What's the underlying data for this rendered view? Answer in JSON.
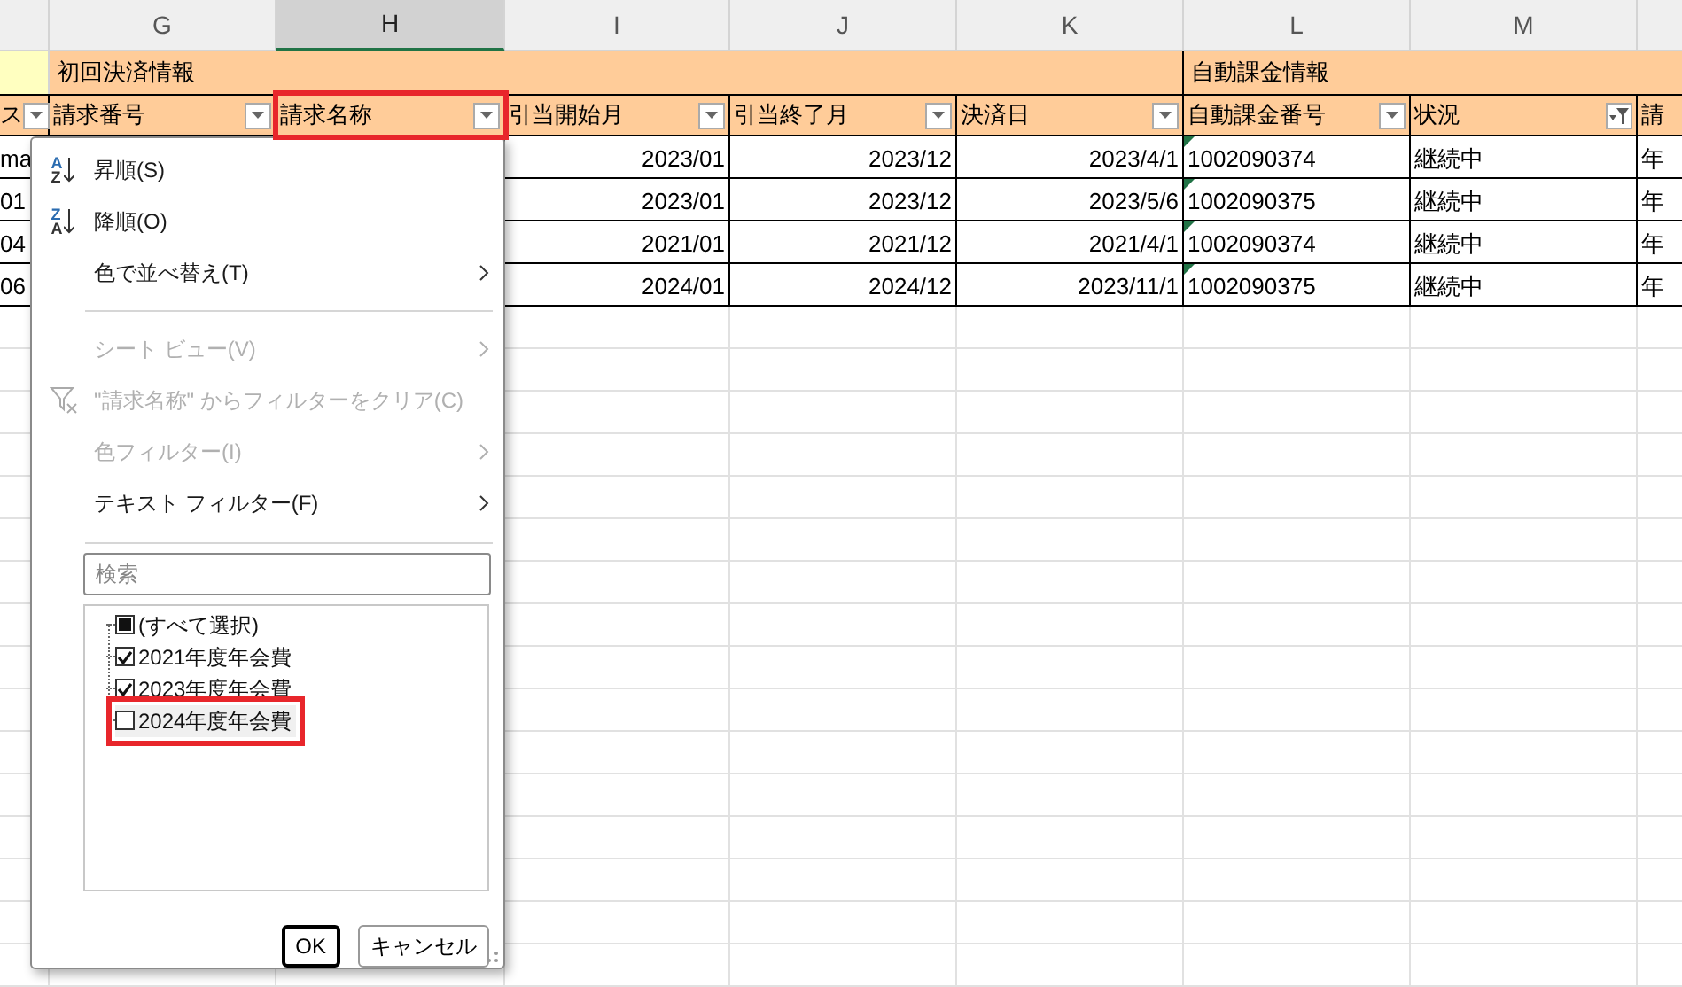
{
  "column_headers": [
    {
      "letter": "G",
      "selected": false
    },
    {
      "letter": "H",
      "selected": true
    },
    {
      "letter": "I",
      "selected": false
    },
    {
      "letter": "J",
      "selected": false
    },
    {
      "letter": "K",
      "selected": false
    },
    {
      "letter": "L",
      "selected": false
    },
    {
      "letter": "M",
      "selected": false
    }
  ],
  "group_headers": [
    {
      "label": "初回決済情報"
    },
    {
      "label": "自動課金情報"
    }
  ],
  "field_headers": [
    {
      "label": "ス",
      "filtered": false,
      "highlighted": false
    },
    {
      "label": "請求番号",
      "filtered": false,
      "highlighted": false
    },
    {
      "label": "請求名称",
      "filtered": false,
      "highlighted": true
    },
    {
      "label": "引当開始月",
      "filtered": false,
      "highlighted": false
    },
    {
      "label": "引当終了月",
      "filtered": false,
      "highlighted": false
    },
    {
      "label": "決済日",
      "filtered": false,
      "highlighted": false
    },
    {
      "label": "自動課金番号",
      "filtered": false,
      "highlighted": false
    },
    {
      "label": "状況",
      "filtered": true,
      "highlighted": false
    },
    {
      "label": "請",
      "highlighted": false
    }
  ],
  "rows": [
    {
      "F": "ma",
      "I": "2023/01",
      "J": "2023/12",
      "K": "2023/4/1",
      "L": "1002090374",
      "number_stored_as_text": true,
      "M": "継続中",
      "N": "年"
    },
    {
      "F": "01",
      "I": "2023/01",
      "J": "2023/12",
      "K": "2023/5/6",
      "L": "1002090375",
      "number_stored_as_text": true,
      "M": "継続中",
      "N": "年"
    },
    {
      "F": "04",
      "I": "2021/01",
      "J": "2021/12",
      "K": "2021/4/1",
      "L": "1002090374",
      "number_stored_as_text": true,
      "M": "継続中",
      "N": "年"
    },
    {
      "F": "06",
      "I": "2024/01",
      "J": "2024/12",
      "K": "2023/11/1",
      "L": "1002090375",
      "number_stored_as_text": true,
      "M": "継続中",
      "N": "年"
    }
  ],
  "filter_menu": {
    "items": [
      {
        "kind": "sort_asc",
        "label": "昇順(S)",
        "icon_letters": [
          "A",
          "Z"
        ],
        "disabled": false,
        "submenu": false
      },
      {
        "kind": "sort_desc",
        "label": "降順(O)",
        "icon_letters": [
          "Z",
          "A"
        ],
        "disabled": false,
        "submenu": false
      },
      {
        "kind": "plain",
        "label": "色で並べ替え(T)",
        "disabled": false,
        "submenu": true
      },
      {
        "kind": "separator"
      },
      {
        "kind": "plain",
        "label": "シート ビュー(V)",
        "disabled": true,
        "submenu": true
      },
      {
        "kind": "clear_filter",
        "label": "\"請求名称\" からフィルターをクリア(C)",
        "disabled": true,
        "submenu": false
      },
      {
        "kind": "plain",
        "label": "色フィルター(I)",
        "disabled": true,
        "submenu": true
      },
      {
        "kind": "plain",
        "label": "テキスト フィルター(F)",
        "disabled": false,
        "submenu": true
      },
      {
        "kind": "separator"
      }
    ],
    "search": {
      "placeholder": "検索"
    },
    "values": [
      {
        "label": "(すべて選択)",
        "checked": true,
        "partial": true,
        "highlighted": false
      },
      {
        "label": "2021年度年会費",
        "checked": true,
        "highlighted": false
      },
      {
        "label": "2023年度年会費",
        "checked": true,
        "highlighted": false
      },
      {
        "label": "2024年度年会費",
        "checked": false,
        "highlighted": true
      }
    ],
    "buttons": [
      {
        "label": "OK",
        "default": true
      },
      {
        "label": "キャンセル",
        "default": false
      }
    ]
  }
}
